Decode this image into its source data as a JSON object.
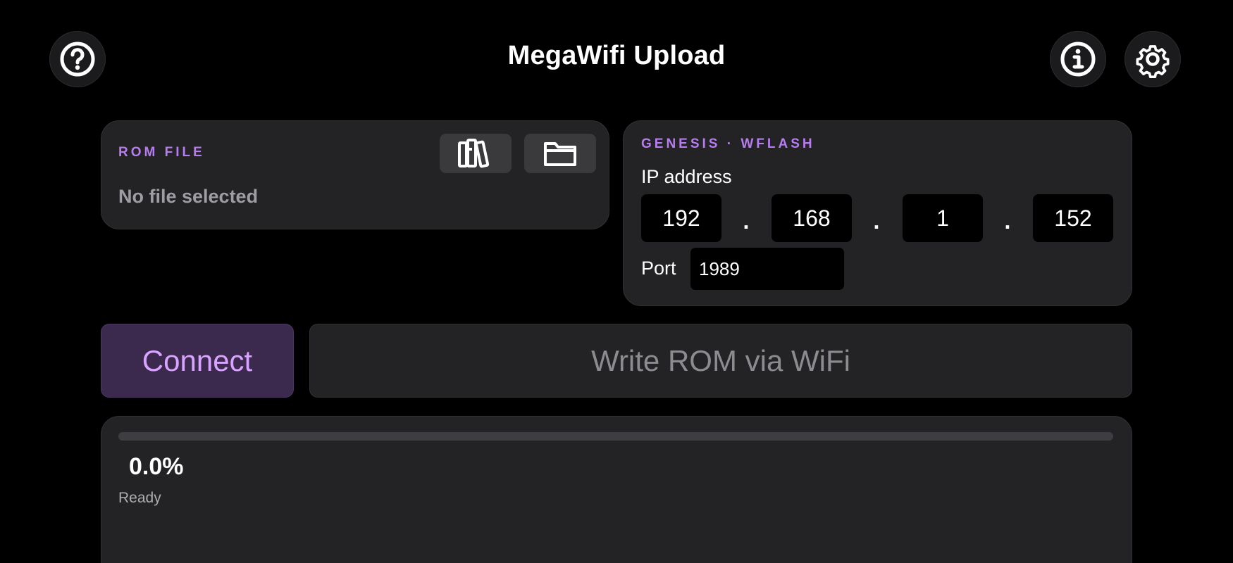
{
  "header": {
    "title": "MegaWifi Upload",
    "help_icon": "question-circle-icon",
    "info_icon": "info-circle-icon",
    "settings_icon": "gear-icon"
  },
  "rom_file": {
    "section_label": "ROM FILE",
    "file_name": "No file selected",
    "library_icon": "books-icon",
    "folder_icon": "folder-icon"
  },
  "connection": {
    "section_label": "GENESIS · WFLASH",
    "ip_label": "IP address",
    "ip_octets": [
      "192",
      "168",
      "1",
      "152"
    ],
    "dot": ".",
    "port_label": "Port",
    "port_value": "1989"
  },
  "actions": {
    "connect_label": "Connect",
    "write_label": "Write ROM via WiFi"
  },
  "progress": {
    "percent_text": "0.0%",
    "fraction": 0.0,
    "status": "Ready"
  },
  "colors": {
    "accent": "#b77cf0",
    "connect_bg": "#3b2a4d",
    "connect_text": "#d8a4ff",
    "card_bg": "#232325"
  }
}
